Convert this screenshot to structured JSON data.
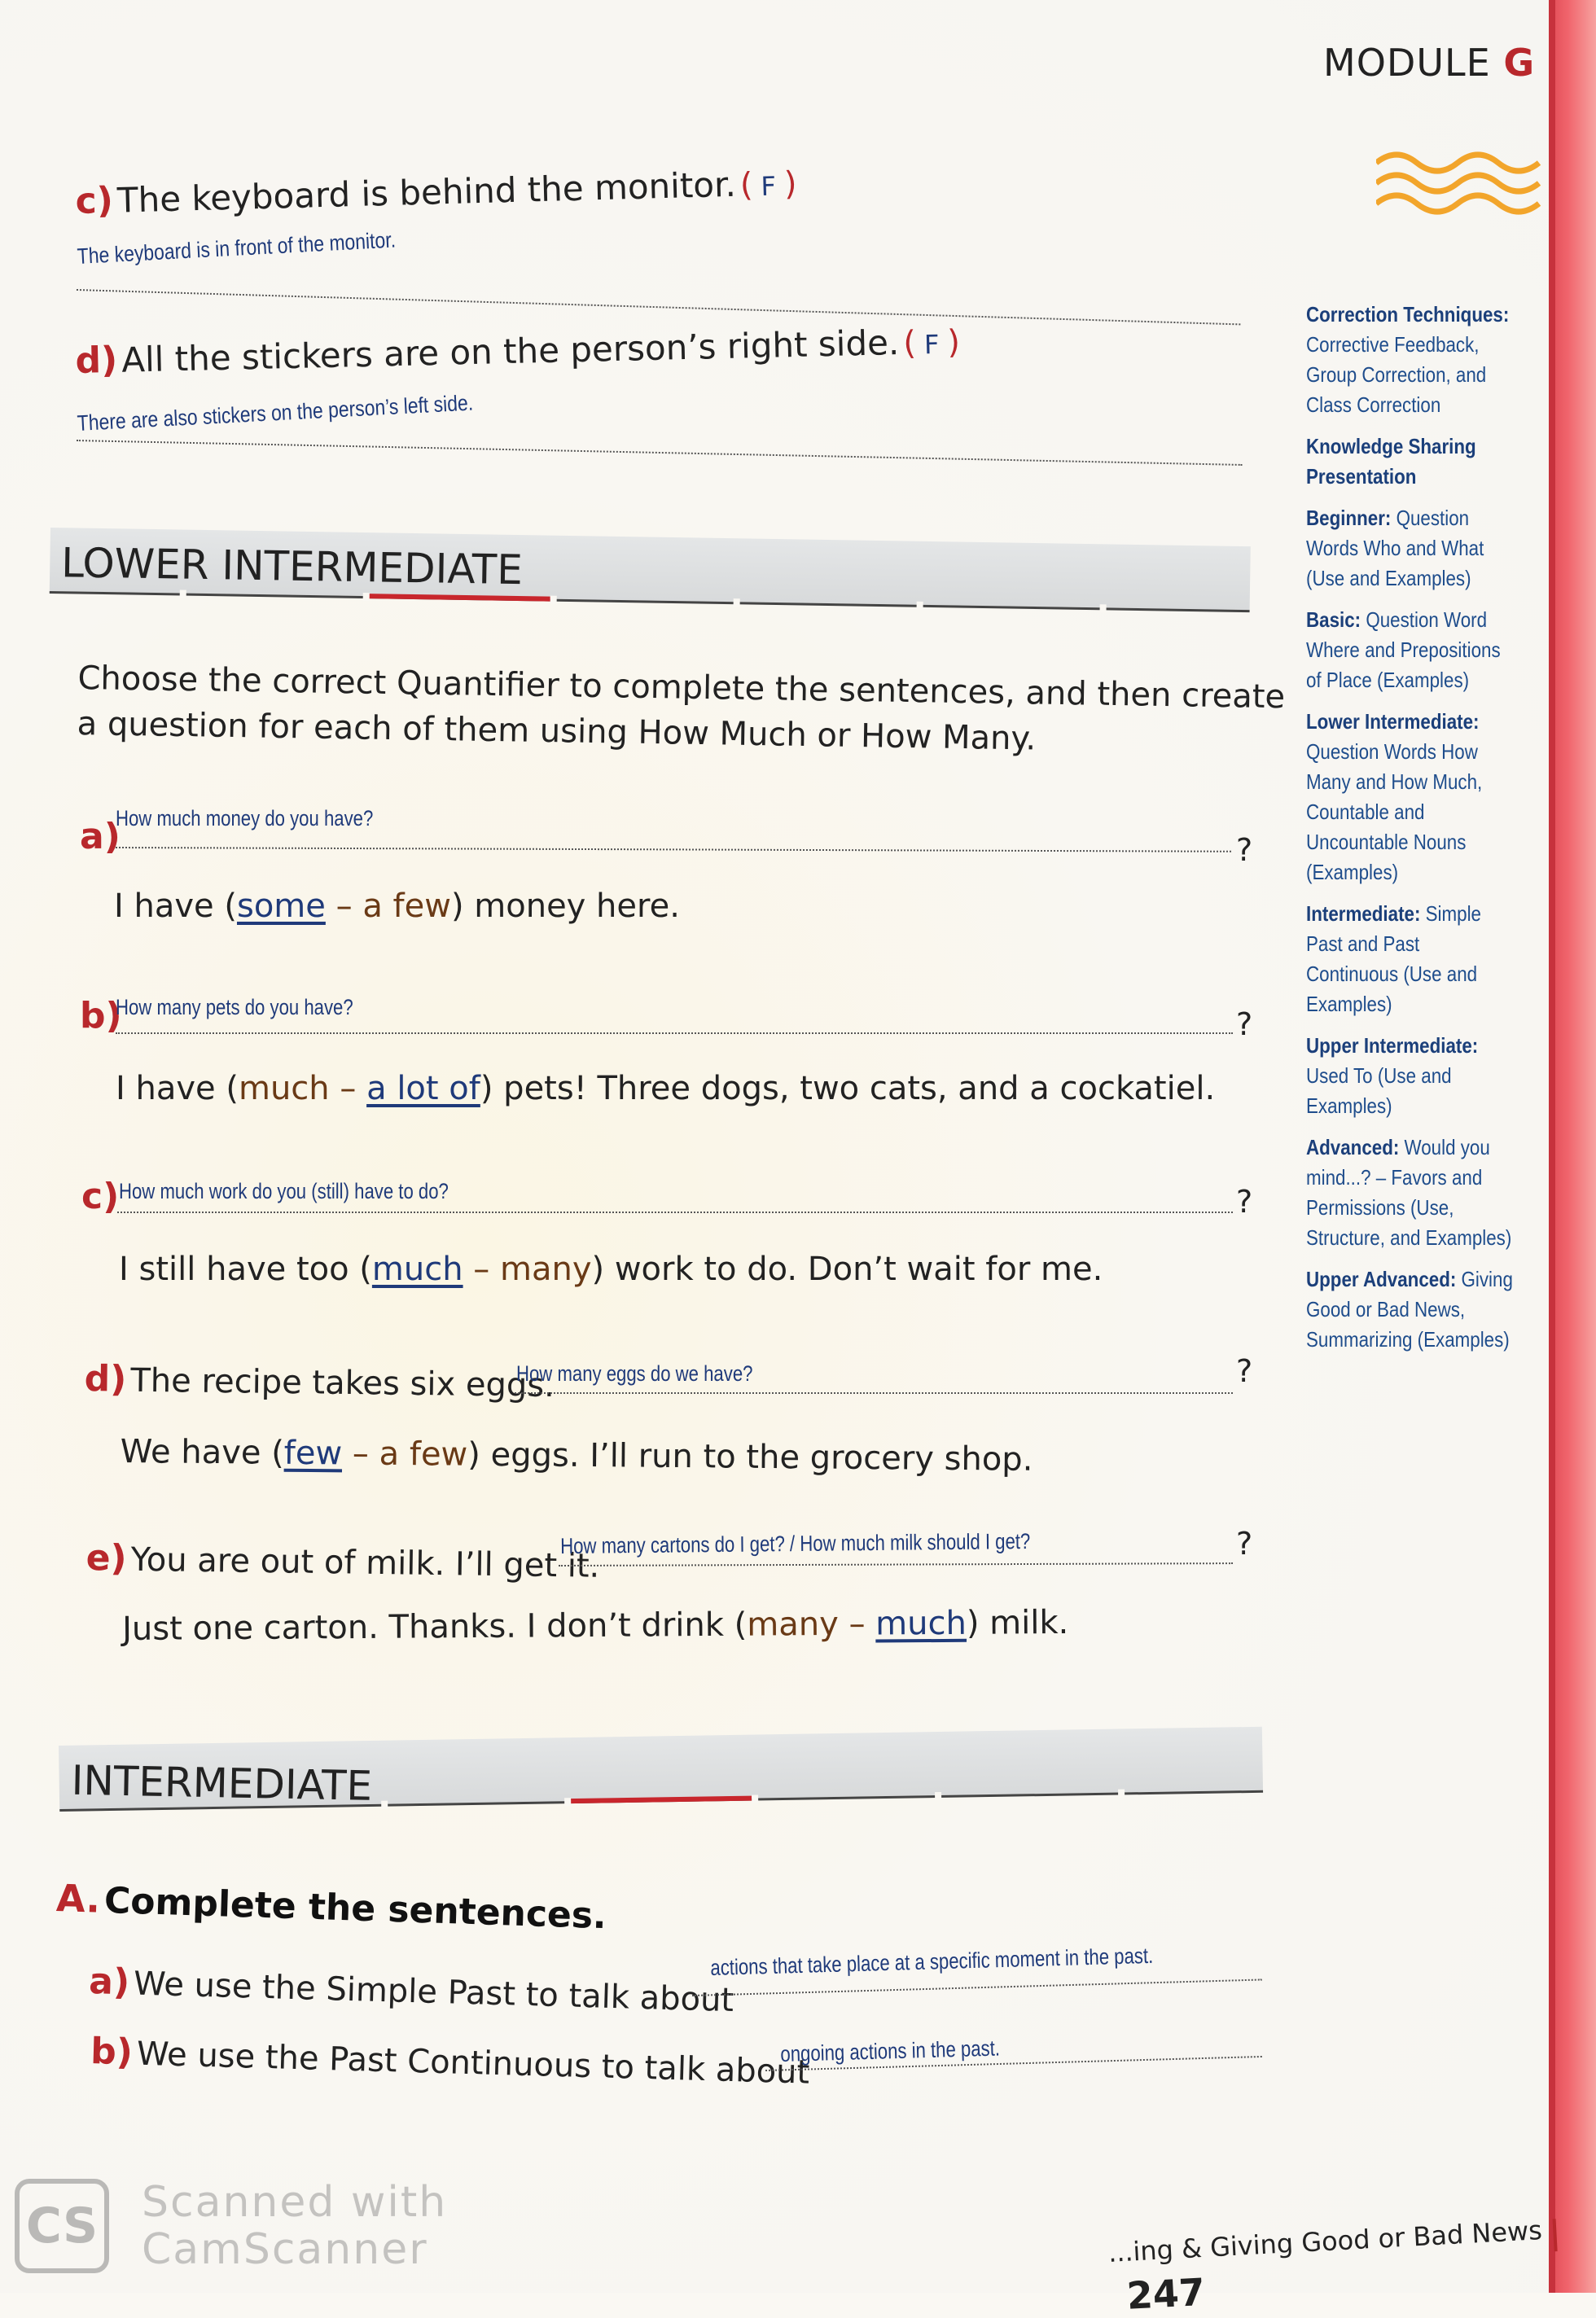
{
  "header": {
    "module_word": "MODULE",
    "module_letter": "G"
  },
  "true_false": [
    {
      "label": "c)",
      "statement": "The keyboard is behind the monitor.",
      "mark": "F",
      "correction": "The keyboard is in front of the monitor."
    },
    {
      "label": "d)",
      "statement": "All the stickers are on the person’s right side.",
      "mark": "F",
      "correction": "There are also stickers on the person’s left side."
    }
  ],
  "lower_intermediate": {
    "title": "LOWER INTERMEDIATE",
    "instructions_line1": "Choose the correct Quantifier to complete the sentences, and then create",
    "instructions_line2": "a question for each of them using How Much or How Many.",
    "items": [
      {
        "label": "a)",
        "prefix": "",
        "answer": "How much money do you have?",
        "before": "I have (",
        "opt1": "some",
        "sep": " – ",
        "opt2": "a few",
        "after": ") money here.",
        "chosen": 1
      },
      {
        "label": "b)",
        "prefix": "",
        "answer": "How many pets do you have?",
        "before": "I have (",
        "opt1": "much",
        "sep": " – ",
        "opt2": "a lot of",
        "after": ") pets! Three dogs, two cats, and a cockatiel.",
        "chosen": 2
      },
      {
        "label": "c)",
        "prefix": "",
        "answer": "How much work do you (still) have to do?",
        "before": "I still have too (",
        "opt1": "much",
        "sep": " – ",
        "opt2": "many",
        "after": ") work to do. Don’t wait for me.",
        "chosen": 1
      },
      {
        "label": "d)",
        "prefix": "The recipe takes six eggs.",
        "answer": "How many eggs do we have?",
        "before": "We have (",
        "opt1": "few",
        "sep": " – ",
        "opt2": "a few",
        "after": ") eggs. I’ll run to the grocery shop.",
        "chosen": 1
      },
      {
        "label": "e)",
        "prefix": "You are out of milk. I’ll get it.",
        "answer": "How many cartons do I get? / How much milk should I get?",
        "before": "Just one carton. Thanks. I don’t drink (",
        "opt1": "many",
        "sep": " – ",
        "opt2": "much",
        "after": ") milk.",
        "chosen": 2
      }
    ],
    "qmark": "?"
  },
  "intermediate": {
    "title": "INTERMEDIATE",
    "section_label": "A.",
    "section_title": "Complete the sentences.",
    "items": [
      {
        "label": "a)",
        "text": "We use the Simple Past to talk about",
        "answer": "actions that take place at a specific moment in the past."
      },
      {
        "label": "b)",
        "text": "We use the Past Continuous to talk about",
        "answer": "ongoing actions in the past."
      }
    ]
  },
  "sidebar": [
    {
      "head": "Correction Techniques:",
      "body": "Corrective Feedback, Group Correction, and Class Correction"
    },
    {
      "head": "Knowledge Sharing Presentation",
      "body": ""
    },
    {
      "head": "Beginner:",
      "body": "Question Words Who and What (Use and Examples)"
    },
    {
      "head": "Basic:",
      "body": "Question Word Where and Prepositions of Place (Examples)"
    },
    {
      "head": "Lower Intermediate:",
      "body": "Question Words How Many and How Much, Countable and Uncountable Nouns (Examples)"
    },
    {
      "head": "Intermediate:",
      "body": "Simple Past and Past Continuous (Use and Examples)"
    },
    {
      "head": "Upper Intermediate:",
      "body": "Used To (Use and Examples)"
    },
    {
      "head": "Advanced:",
      "body": "Would you mind...? – Favors and Permissions (Use, Structure, and Examples)"
    },
    {
      "head": "Upper Advanced:",
      "body": "Giving Good or Bad News, Summarizing (Examples)"
    }
  ],
  "footer": {
    "running_title": "...ing & Giving Good or Bad News",
    "page_number": "247"
  },
  "watermark": {
    "logo": "CS",
    "line1": "Scanned with",
    "line2": "CamScanner"
  },
  "colors": {
    "accent_red": "#b8282c",
    "answer_blue": "#1f3a7a",
    "sidebar_blue": "#1f4d8c",
    "edge_red": "#e04a55"
  }
}
